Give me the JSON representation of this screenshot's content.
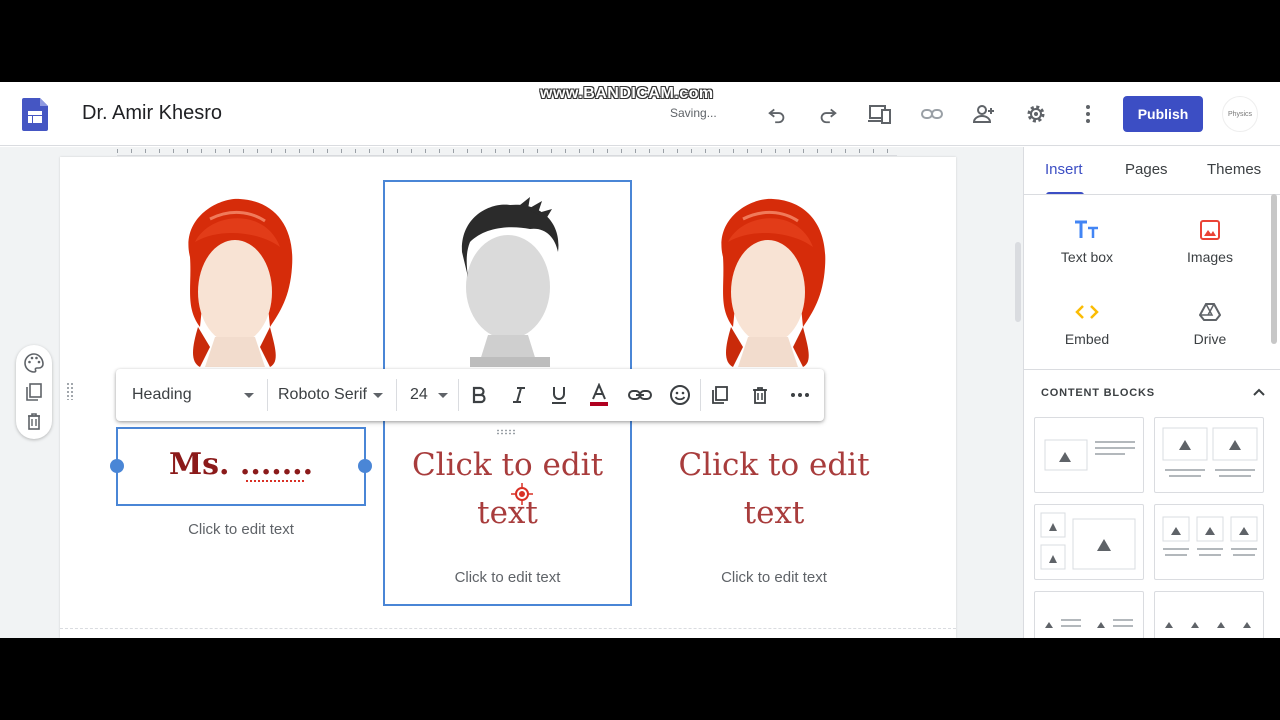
{
  "header": {
    "title": "Dr. Amir Khesro",
    "watermark": "www.BANDICAM.com",
    "status": "Saving...",
    "publish_label": "Publish",
    "avatar_text": "Physics"
  },
  "columns": [
    {
      "heading": "Ms. .......",
      "subtext": "Click to edit text"
    },
    {
      "heading": "Click to edit text",
      "subtext": "Click to edit text"
    },
    {
      "heading": "Click to edit text",
      "subtext": "Click to edit text"
    }
  ],
  "format_toolbar": {
    "style": "Heading",
    "font": "Roboto Serif",
    "size": "24"
  },
  "panel": {
    "tabs": [
      "Insert",
      "Pages",
      "Themes"
    ],
    "active_tab": "Insert",
    "insert_items": [
      {
        "label": "Text box",
        "icon": "text-box-icon"
      },
      {
        "label": "Images",
        "icon": "image-icon"
      },
      {
        "label": "Embed",
        "icon": "embed-icon"
      },
      {
        "label": "Drive",
        "icon": "drive-icon"
      }
    ],
    "content_blocks_label": "CONTENT BLOCKS"
  },
  "colors": {
    "accent": "#3c4ec4",
    "heading": "#a83c3c",
    "selection": "#4a86d6"
  }
}
